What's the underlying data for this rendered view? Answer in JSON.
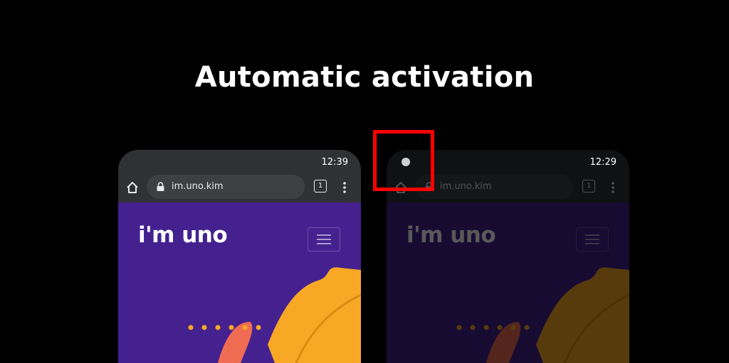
{
  "headline": "Automatic activation",
  "colors": {
    "background": "#000000",
    "site_purple": "#44218f",
    "accent_orange": "#f9a825",
    "highlight_red": "#ff0000",
    "browser_chrome": "#303134"
  },
  "phones": [
    {
      "state": "normal",
      "status_time": "12:39",
      "url": "im.uno.kim",
      "tab_count": "1",
      "site_logo": "i'm uno",
      "icons": [
        "home-icon",
        "lock-icon",
        "tabs-icon",
        "overflow-menu-icon",
        "hamburger-menu-icon"
      ]
    },
    {
      "state": "dimmed",
      "status_time": "12:29",
      "url": "im.uno.kim",
      "tab_count": "1",
      "site_logo": "i'm uno",
      "icons": [
        "night-mode-icon",
        "home-icon",
        "lock-icon",
        "tabs-icon",
        "overflow-menu-icon",
        "hamburger-menu-icon"
      ]
    }
  ]
}
